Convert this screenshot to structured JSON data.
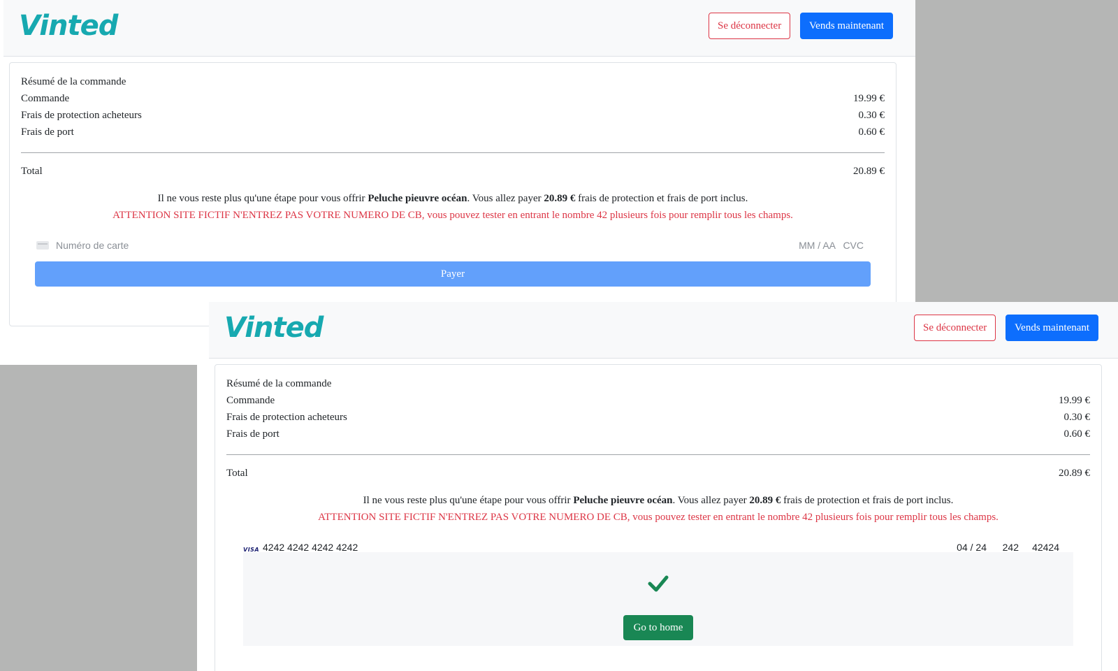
{
  "colors": {
    "brand": "#17a9b0",
    "danger": "#dc3545",
    "primary": "#0d6efd",
    "pay_button": "#62a0fb",
    "success": "#198754",
    "backdrop": "#b5b6b5"
  },
  "screens": [
    {
      "navbar": {
        "logo": "Vinted",
        "logout_label": "Se déconnecter",
        "sell_label": "Vends maintenant"
      },
      "summary": {
        "title": "Résumé de la commande",
        "rows": [
          {
            "label": "Commande",
            "value": "19.99 €"
          },
          {
            "label": "Frais de protection acheteurs",
            "value": "0.30 €"
          },
          {
            "label": "Frais de port",
            "value": "0.60 €"
          }
        ],
        "total_label": "Total",
        "total_value": "20.89 €"
      },
      "info": {
        "part1": "Il ne vous reste plus qu'une étape pour vous offrir ",
        "product": "Peluche pieuvre océan",
        "part2": ". Vous allez payer ",
        "amount": "20.89 €",
        "part3": " frais de protection et frais de port inclus.",
        "warning": "ATTENTION SITE FICTIF N'ENTREZ PAS VOTRE NUMERO DE CB, vous pouvez tester en entrant le nombre 42 plusieurs fois pour remplir tous les champs."
      },
      "card_form": {
        "card_icon": "credit-card-icon",
        "number_placeholder": "Numéro de carte",
        "expiry_placeholder": "MM / AA",
        "cvc_placeholder": "CVC"
      },
      "pay_label": "Payer"
    },
    {
      "navbar": {
        "logo": "Vinted",
        "logout_label": "Se déconnecter",
        "sell_label": "Vends maintenant"
      },
      "summary": {
        "title": "Résumé de la commande",
        "rows": [
          {
            "label": "Commande",
            "value": "19.99 €"
          },
          {
            "label": "Frais de protection acheteurs",
            "value": "0.30 €"
          },
          {
            "label": "Frais de port",
            "value": "0.60 €"
          }
        ],
        "total_label": "Total",
        "total_value": "20.89 €"
      },
      "info": {
        "part1": "Il ne vous reste plus qu'une étape pour vous offrir ",
        "product": "Peluche pieuvre océan",
        "part2": ". Vous allez payer ",
        "amount": "20.89 €",
        "part3": " frais de protection et frais de port inclus.",
        "warning": "ATTENTION SITE FICTIF N'ENTREZ PAS VOTRE NUMERO DE CB, vous pouvez tester en entrant le nombre 42 plusieurs fois pour remplir tous les champs."
      },
      "card_form": {
        "brand_icon": "visa-icon",
        "brand_text": "VISA",
        "number": "4242 4242 4242 4242",
        "expiry": "04 / 24",
        "cvc": "242",
        "zip": "42424"
      },
      "success": {
        "icon": "checkmark-icon",
        "home_label": "Go to home"
      }
    }
  ]
}
